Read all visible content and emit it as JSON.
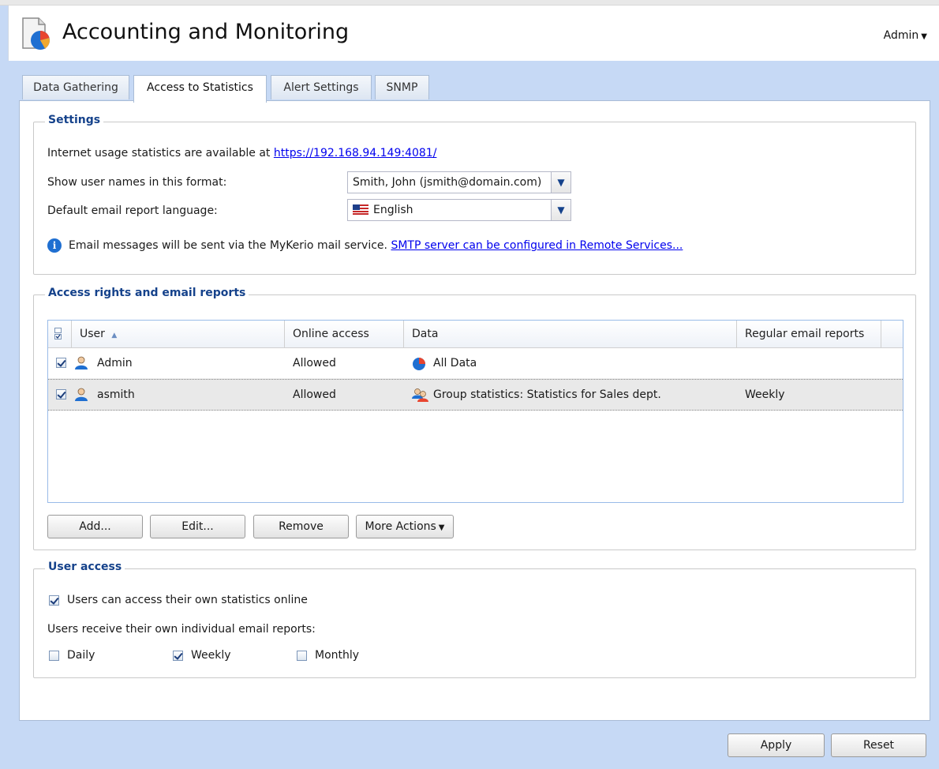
{
  "header": {
    "title": "Accounting and Monitoring",
    "user_menu": "Admin"
  },
  "tabs": [
    {
      "label": "Data Gathering",
      "active": false
    },
    {
      "label": "Access to Statistics",
      "active": true
    },
    {
      "label": "Alert Settings",
      "active": false
    },
    {
      "label": "SNMP",
      "active": false
    }
  ],
  "settings": {
    "legend": "Settings",
    "stats_url_label": "Internet usage statistics are available at",
    "stats_url": "https://192.168.94.149:4081/",
    "user_format_label": "Show user names in this format:",
    "user_format_value": "Smith, John (jsmith@domain.com)",
    "language_label": "Default email report language:",
    "language_value": "English",
    "info_text": "Email messages will be sent via the MyKerio mail service.",
    "info_link": "SMTP server can be configured in Remote Services..."
  },
  "access_rights": {
    "legend": "Access rights and email reports",
    "columns": [
      "User",
      "Online access",
      "Data",
      "Regular email reports"
    ],
    "rows": [
      {
        "checked": true,
        "user": "Admin",
        "online_access": "Allowed",
        "data": "All Data",
        "data_icon": "pie-chart-icon",
        "reports": ""
      },
      {
        "checked": true,
        "user": "asmith",
        "online_access": "Allowed",
        "data": "Group statistics: Statistics for Sales dept.",
        "data_icon": "group-icon",
        "reports": "Weekly"
      }
    ],
    "buttons": {
      "add": "Add...",
      "edit": "Edit...",
      "remove": "Remove",
      "more": "More Actions"
    }
  },
  "user_access": {
    "legend": "User access",
    "online_label": "Users can access their own statistics online",
    "online_checked": true,
    "reports_label": "Users receive their own individual email reports:",
    "daily_label": "Daily",
    "daily_checked": false,
    "weekly_label": "Weekly",
    "weekly_checked": true,
    "monthly_label": "Monthly",
    "monthly_checked": false
  },
  "footer": {
    "apply": "Apply",
    "reset": "Reset"
  },
  "colors": {
    "accent": "#15428b",
    "background": "#c6d9f5",
    "link": "#0000ee"
  }
}
